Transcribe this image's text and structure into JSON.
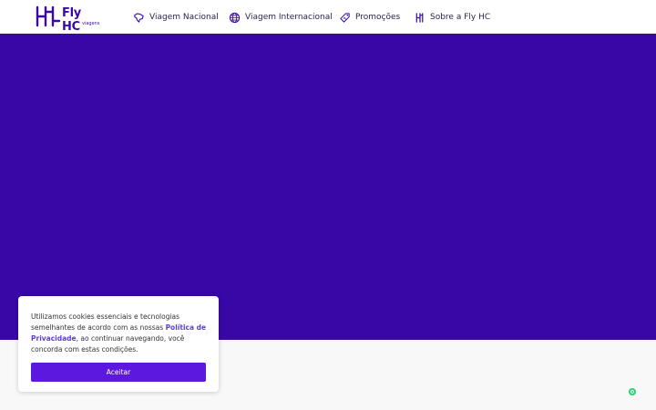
{
  "header": {
    "logo": {
      "name": "Fly HC",
      "sub": "viagens"
    },
    "nav": [
      {
        "label": "Viagem Nacional",
        "icon": "brazil-map-icon"
      },
      {
        "label": "Viagem Internacional",
        "icon": "globe-icon"
      },
      {
        "label": "Promoções",
        "icon": "tag-plane-icon"
      },
      {
        "label": "Sobre a Fly HC",
        "icon": "fly-hc-mark-icon"
      }
    ]
  },
  "cookie_banner": {
    "text_before": "Utilizamos cookies essenciais e tecnologias semelhantes de acordo com as nossas ",
    "link_label": "Política de Privacidade",
    "text_after": ", ao continuar navegando, você concorda com estas condições.",
    "accept_label": "Aceitar"
  },
  "colors": {
    "brand": "#3b07a8",
    "hero": "#3907a6",
    "accept_button": "#5d18e0",
    "link": "#5b3fd6",
    "whatsapp": "#25d366"
  }
}
